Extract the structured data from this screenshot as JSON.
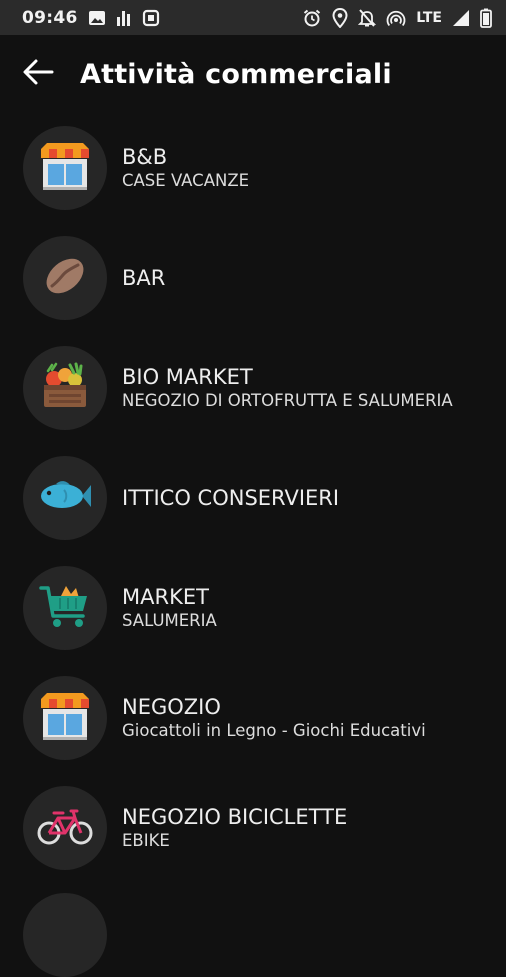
{
  "status_bar": {
    "time": "09:46",
    "network_label": "LTE",
    "left_icons": [
      "image-icon",
      "signal-bars-icon",
      "square-icon"
    ],
    "right_icons": [
      "alarm-icon",
      "location-icon",
      "notifications-off-icon",
      "hotspot-icon",
      "cellular-signal-icon",
      "battery-icon"
    ]
  },
  "header": {
    "title": "Attività commerciali",
    "back_icon": "arrow-left-icon"
  },
  "items": [
    {
      "title": "B&B",
      "subtitle": "CASE VACANZE",
      "icon": "shop-icon"
    },
    {
      "title": "BAR",
      "subtitle": "",
      "icon": "coffee-bean-icon"
    },
    {
      "title": "BIO MARKET",
      "subtitle": "NEGOZIO DI ORTOFRUTTA E SALUMERIA",
      "icon": "produce-crate-icon"
    },
    {
      "title": "ITTICO CONSERVIERI",
      "subtitle": "",
      "icon": "fish-icon"
    },
    {
      "title": "MARKET",
      "subtitle": "SALUMERIA",
      "icon": "shopping-cart-icon"
    },
    {
      "title": "NEGOZIO",
      "subtitle": "Giocattoli in Legno - Giochi Educativi",
      "icon": "shop-icon"
    },
    {
      "title": "NEGOZIO BICICLETTE",
      "subtitle": "EBIKE",
      "icon": "bicycle-icon"
    }
  ],
  "colors": {
    "background": "#111111",
    "status_bar": "#2b2b2b",
    "avatar_bg": "#262626"
  }
}
